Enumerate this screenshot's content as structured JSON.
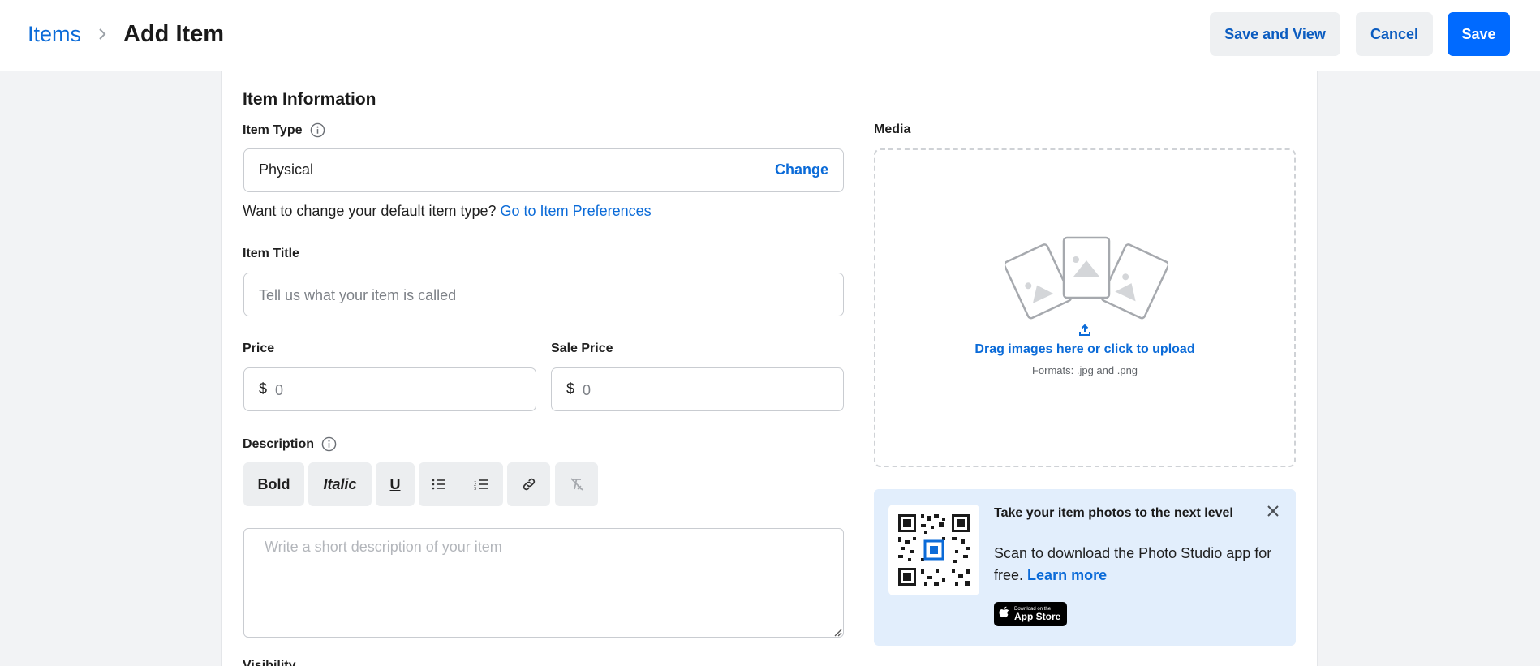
{
  "header": {
    "breadcrumb_parent": "Items",
    "page_title": "Add Item",
    "save_and_view_label": "Save and View",
    "cancel_label": "Cancel",
    "save_label": "Save"
  },
  "item_info": {
    "section_title": "Item Information",
    "item_type_label": "Item Type",
    "item_type_value": "Physical",
    "change_label": "Change",
    "help_text": "Want to change your default item type?",
    "help_link": "Go to Item Preferences",
    "title_label": "Item Title",
    "title_placeholder": "Tell us what your item is called",
    "price_label": "Price",
    "sale_price_label": "Sale Price",
    "currency_symbol": "$",
    "price_placeholder": "0",
    "sale_price_placeholder": "0",
    "description_label": "Description",
    "description_placeholder": "Write a short description of your item",
    "toolbar": {
      "bold": "Bold",
      "italic": "Italic",
      "underline": "U"
    },
    "next_section_label": "Visibility"
  },
  "media": {
    "label": "Media",
    "upload_text": "Drag images here or click to upload",
    "formats_text": "Formats: .jpg and .png"
  },
  "promo": {
    "title": "Take your item photos to the next level",
    "body": "Scan to download the Photo Studio app for free.",
    "link": "Learn more",
    "appstore_small": "Download on the",
    "appstore_big": "App Store"
  },
  "colors": {
    "primary": "#006aff",
    "link": "#0b6bd8",
    "promo_bg": "#e2eefc",
    "page_bg": "#f2f3f5"
  },
  "icons": [
    "chevron-right-icon",
    "info-icon",
    "upload-icon",
    "images-icon",
    "bullet-list-icon",
    "numbered-list-icon",
    "link-icon",
    "clear-format-icon",
    "close-icon",
    "qr-code-icon",
    "apple-icon"
  ]
}
